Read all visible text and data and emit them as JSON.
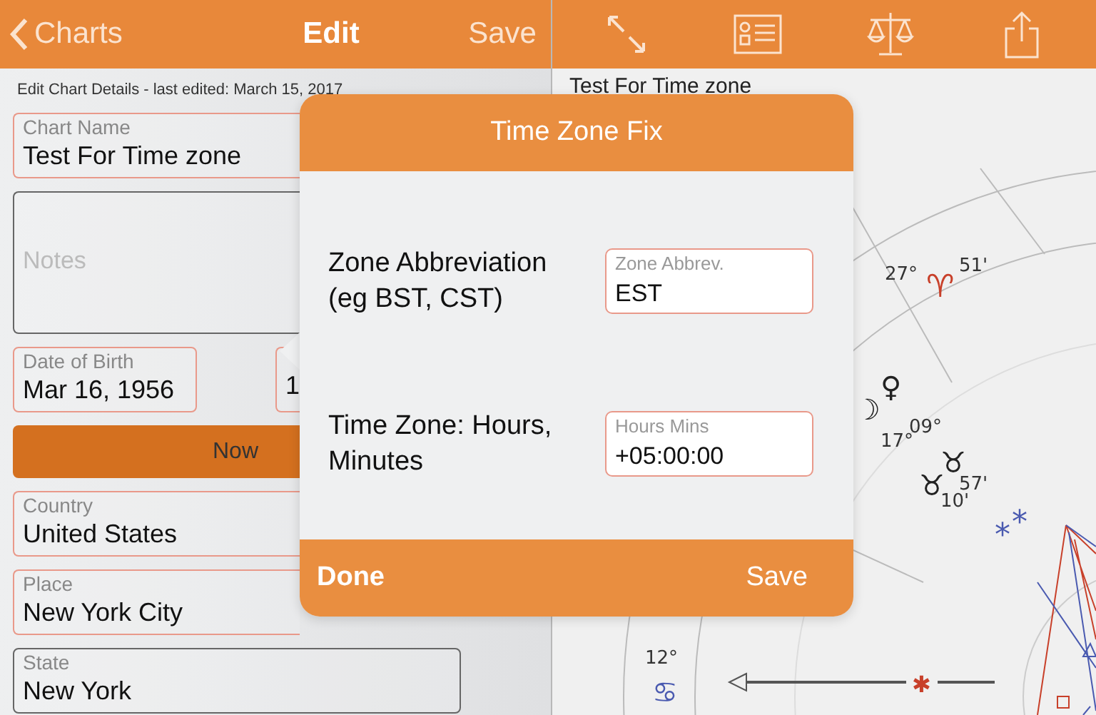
{
  "nav_bar": {
    "back_label": "Charts",
    "title": "Edit",
    "save_label": "Save"
  },
  "form": {
    "subtitle": "Edit Chart Details - last edited: March 15, 2017",
    "chart_name": {
      "label": "Chart Name",
      "value": "Test For Time zone",
      "highlighted": true
    },
    "notes": {
      "placeholder": "Notes",
      "highlighted": false
    },
    "date_of_birth": {
      "label": "Date of Birth",
      "value": "Mar 16, 1956",
      "highlighted": true
    },
    "time_of_birth": {
      "value": "1",
      "highlighted": true
    },
    "now_button": "Now",
    "country": {
      "label": "Country",
      "value": "United States",
      "highlighted": true
    },
    "place": {
      "label": "Place",
      "value": "New York City",
      "highlighted": true
    },
    "state": {
      "label": "State",
      "value": "New York",
      "highlighted": false
    }
  },
  "chart_panel": {
    "title": "Test For Time zone",
    "labels": [
      {
        "text": "51'",
        "kind": "degree"
      },
      {
        "text": "♈",
        "kind": "sign"
      },
      {
        "text": "27°",
        "kind": "degree"
      },
      {
        "text": "♀",
        "kind": "planet"
      },
      {
        "text": "☽",
        "kind": "planet"
      },
      {
        "text": "09°",
        "kind": "degree"
      },
      {
        "text": "17°",
        "kind": "degree"
      },
      {
        "text": "♉",
        "kind": "planet"
      },
      {
        "text": "♉",
        "kind": "planet"
      },
      {
        "text": "57'",
        "kind": "degree"
      },
      {
        "text": "10'",
        "kind": "degree"
      },
      {
        "text": "*",
        "kind": "point"
      },
      {
        "text": "*",
        "kind": "point"
      },
      {
        "text": "12°",
        "kind": "degree"
      },
      {
        "text": "♋",
        "kind": "cusp_sign"
      },
      {
        "text": "✱",
        "kind": "aspect_point"
      }
    ]
  },
  "dialog": {
    "title": "Time Zone Fix",
    "rows": [
      {
        "label": "Zone Abbreviation (eg BST, CST)",
        "field_label": "Zone Abbrev.",
        "value": "EST"
      },
      {
        "label": "Time Zone: Hours, Minutes",
        "field_label": "Hours Mins",
        "value": "+05:00:00"
      }
    ],
    "done_label": "Done",
    "save_label": "Save"
  }
}
